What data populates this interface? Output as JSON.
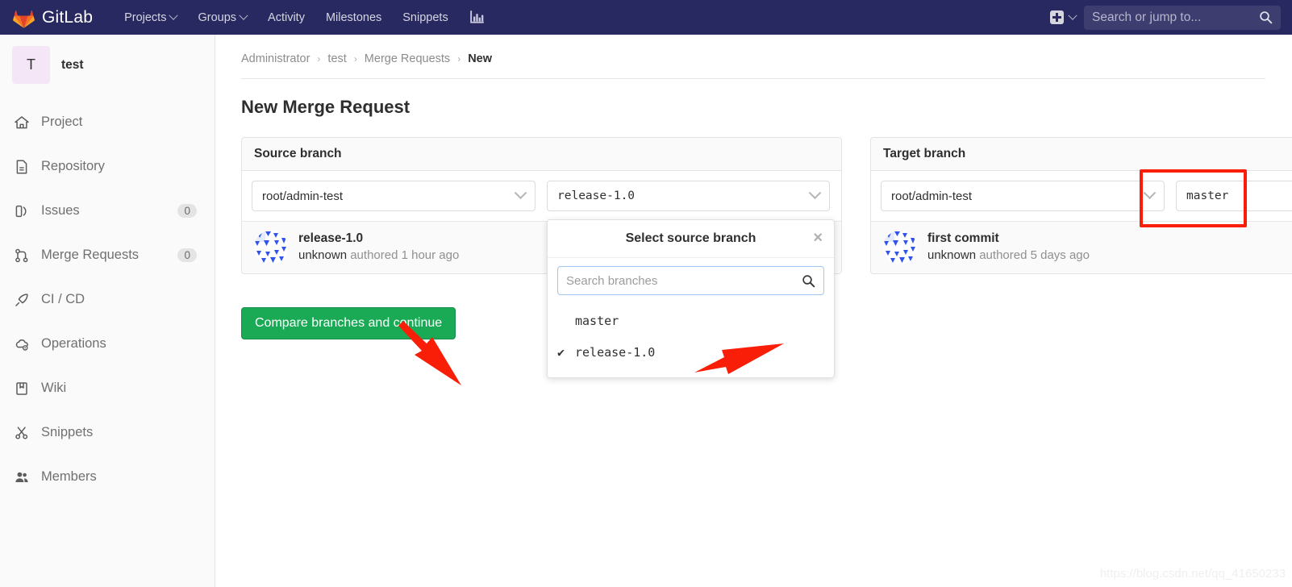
{
  "navbar": {
    "brand": "GitLab",
    "brand_logo_icon": "gitlab-tanuki-logo",
    "links": [
      {
        "label": "Projects",
        "has_caret": true
      },
      {
        "label": "Groups",
        "has_caret": true
      },
      {
        "label": "Activity",
        "has_caret": false
      },
      {
        "label": "Milestones",
        "has_caret": false
      },
      {
        "label": "Snippets",
        "has_caret": false
      }
    ],
    "chart_icon": "analytics-chart-icon",
    "plus_icon": "plus-square-icon",
    "plus_caret_icon": "chevron-down-icon",
    "search": {
      "placeholder": "Search or jump to...",
      "value": "",
      "icon": "search-icon"
    },
    "bg_color": "#292961"
  },
  "sidebar": {
    "project": {
      "initial": "T",
      "name": "test",
      "avatar_bg": "#f4e6f6"
    },
    "items": [
      {
        "label": "Project",
        "icon": "home-icon",
        "badge": ""
      },
      {
        "label": "Repository",
        "icon": "document-icon",
        "badge": ""
      },
      {
        "label": "Issues",
        "icon": "issues-icon",
        "badge": "0"
      },
      {
        "label": "Merge Requests",
        "icon": "merge-request-icon",
        "badge": "0"
      },
      {
        "label": "CI / CD",
        "icon": "rocket-icon",
        "badge": ""
      },
      {
        "label": "Operations",
        "icon": "operations-cloud-gear-icon",
        "badge": ""
      },
      {
        "label": "Wiki",
        "icon": "book-icon",
        "badge": ""
      },
      {
        "label": "Snippets",
        "icon": "scissors-icon",
        "badge": ""
      },
      {
        "label": "Members",
        "icon": "people-icon",
        "badge": ""
      }
    ]
  },
  "breadcrumb": {
    "items": [
      "Administrator",
      "test",
      "Merge Requests",
      "New"
    ],
    "separator": "›"
  },
  "page": {
    "title": "New Merge Request"
  },
  "source_card": {
    "header": "Source branch",
    "project_select": {
      "value": "root/admin-test",
      "icon": "chevron-down-icon"
    },
    "branch_select": {
      "value": "release-1.0",
      "icon": "chevron-down-icon"
    },
    "commit": {
      "avatar_icon": "identicon-avatar",
      "title": "release-1.0",
      "author": "unknown",
      "meta": "authored 1 hour ago"
    }
  },
  "target_card": {
    "header": "Target branch",
    "project_select": {
      "value": "root/admin-test",
      "icon": "chevron-down-icon"
    },
    "branch_select": {
      "value": "master",
      "icon": ""
    },
    "commit": {
      "avatar_icon": "identicon-avatar",
      "title": "first commit",
      "author": "unknown",
      "meta": "authored 5 days ago"
    }
  },
  "dropdown": {
    "title": "Select source branch",
    "close_icon": "close-icon",
    "search": {
      "placeholder": "Search branches",
      "value": "",
      "icon": "search-icon"
    },
    "items": [
      {
        "label": "master",
        "selected": false
      },
      {
        "label": "release-1.0",
        "selected": true
      }
    ],
    "check_glyph": "✔"
  },
  "compare_button": {
    "label": "Compare branches and continue",
    "color": "#1aaa55"
  },
  "annotations": {
    "highlight_color": "#f81e07",
    "rect_label": "target-branch-dropdown-highlight",
    "arrow_1_label": "arrow-to-compare-button",
    "arrow_2_label": "arrow-to-release-branch-option"
  },
  "watermark": {
    "text": "https://blog.csdn.net/qq_41650233"
  }
}
